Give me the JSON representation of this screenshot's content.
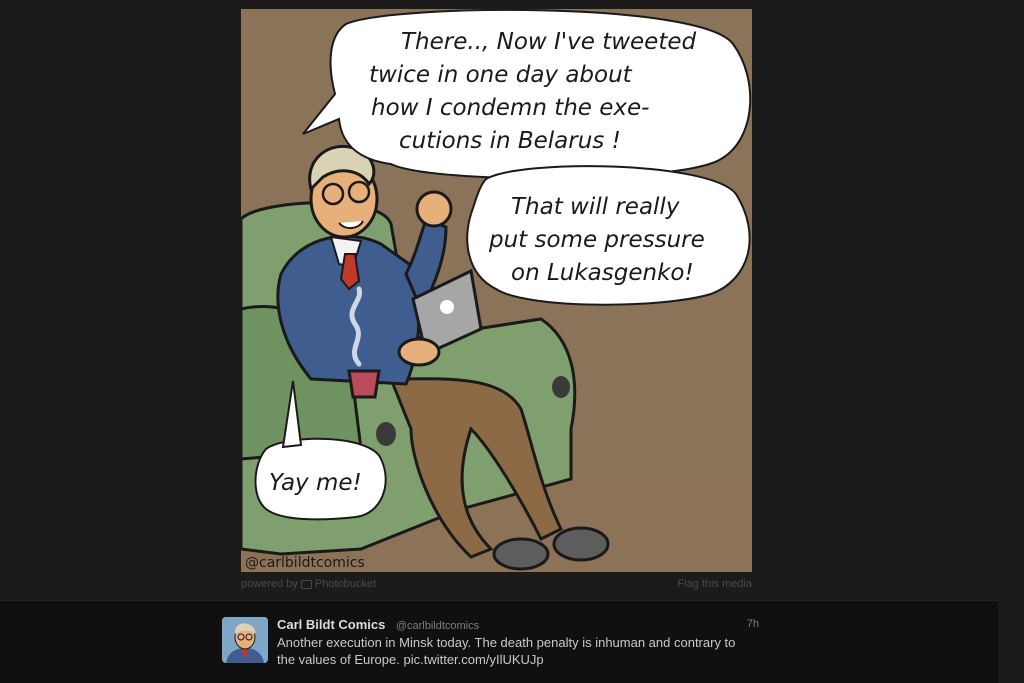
{
  "media": {
    "comic_lines": {
      "bubble1": [
        "There.., Now I've tweeted",
        "twice in one day about",
        "how I condemn the exe-",
        "cutions in Belarus !"
      ],
      "bubble2": [
        "That will really",
        "put some pressure",
        "on Lukasgenko!"
      ],
      "bubble3": "Yay me!",
      "watermark": "@carlbildtcomics"
    },
    "powered_by_label": "powered by",
    "provider_name": "Photobucket",
    "flag_label": "Flag this media"
  },
  "tweet": {
    "author_name": "Carl Bildt Comics",
    "author_handle": "@carlbildtcomics",
    "time": "7h",
    "text_line1": "Another execution in Minsk today. The death penalty is inhuman and contrary to",
    "text_line2_prefix": "the values of Europe. ",
    "link": "pic.twitter.com/yIlUKUJp"
  },
  "colors": {
    "page_background": "#1b1b1b",
    "tweet_bar_background": "#101010",
    "comic_background": "#8a7358",
    "chair_green": "#7fa06e",
    "sweater_blue": "#3f5d8e"
  },
  "icons": {
    "photobucket": "camera-frame-icon",
    "avatar": "caricature-avatar"
  }
}
